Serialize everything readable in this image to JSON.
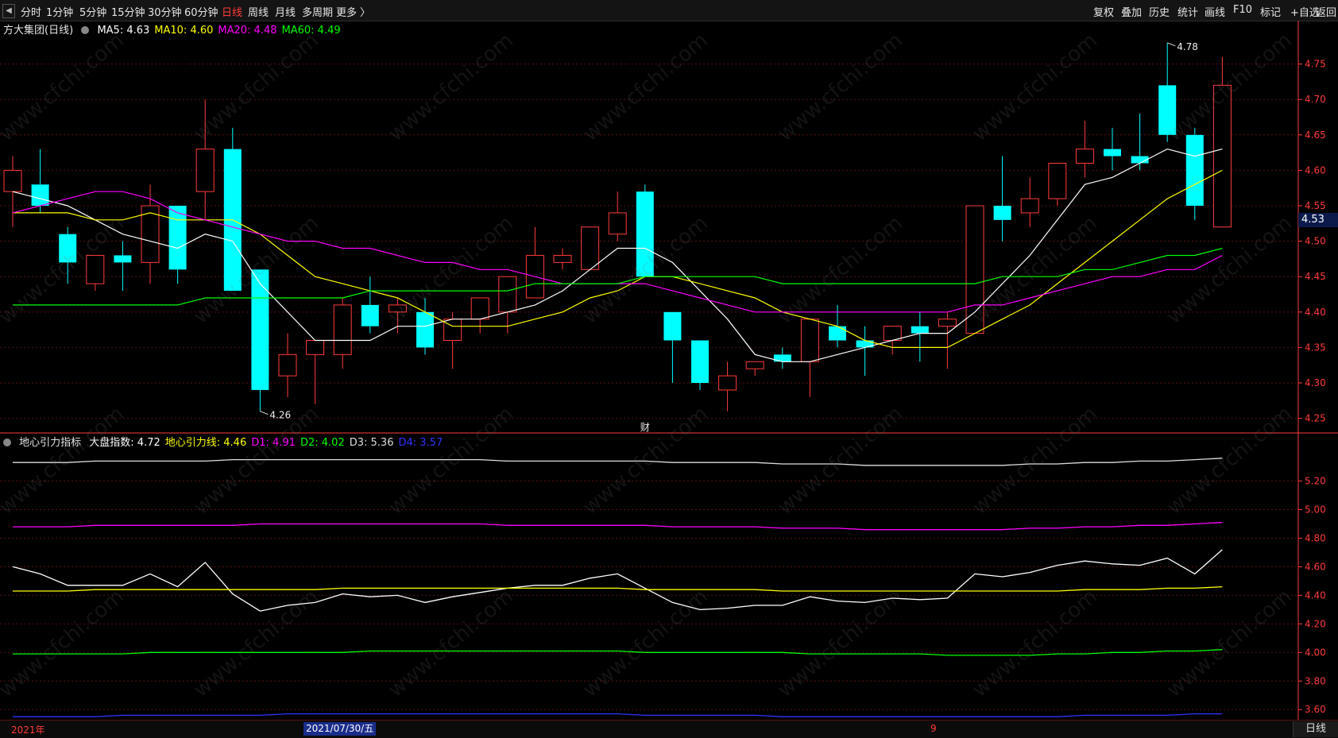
{
  "toolbar": {
    "left_items": [
      "分时",
      "1分钟",
      "5分钟",
      "15分钟",
      "30分钟",
      "60分钟",
      "日线",
      "周线",
      "月线",
      "多周期",
      "更多 〉"
    ],
    "active_index": 6,
    "right_items": [
      "复权",
      "叠加",
      "历史",
      "统计",
      "画线",
      "F10",
      "+自选",
      "返回"
    ],
    "mark_label": "标记"
  },
  "main_legend": {
    "title": "方大集团(日线)",
    "items": [
      {
        "label": "MA5: 4.63",
        "color": "#ffffff"
      },
      {
        "label": "MA10: 4.60",
        "color": "#ffff00"
      },
      {
        "label": "MA20: 4.48",
        "color": "#ff00ff"
      },
      {
        "label": "MA60: 4.49",
        "color": "#00ff00"
      }
    ]
  },
  "sub_legend": {
    "title": "地心引力指标",
    "items": [
      {
        "label": "大盘指数: 4.72",
        "color": "#ffffff"
      },
      {
        "label": "地心引力线: 4.46",
        "color": "#ffff00"
      },
      {
        "label": "D1: 4.91",
        "color": "#ff00ff"
      },
      {
        "label": "D2: 4.02",
        "color": "#00ff00"
      },
      {
        "label": "D3: 5.36",
        "color": "#dddddd"
      },
      {
        "label": "D4: 3.57",
        "color": "#3333ff"
      }
    ]
  },
  "price_tag": "4.53",
  "watermark": "www.cfchi.com",
  "bottom": {
    "year_label": "2021年",
    "date_label": "2021/07/30/五",
    "month_label": "9",
    "daily_button": "日线"
  },
  "colors": {
    "up": "#ff3b3b",
    "down": "#00ffff",
    "axis": "#ff3b3b",
    "grid": "#5a1010"
  },
  "chart_data": [
    {
      "type": "candlestick",
      "title": "方大集团(日线)",
      "ylim": [
        4.235,
        4.8
      ],
      "yticks": [
        4.25,
        4.3,
        4.35,
        4.4,
        4.45,
        4.5,
        4.55,
        4.6,
        4.65,
        4.7,
        4.75
      ],
      "candles": [
        {
          "o": 4.57,
          "c": 4.6,
          "h": 4.62,
          "l": 4.52
        },
        {
          "o": 4.58,
          "c": 4.55,
          "h": 4.63,
          "l": 4.54
        },
        {
          "o": 4.51,
          "c": 4.47,
          "h": 4.52,
          "l": 4.44
        },
        {
          "o": 4.44,
          "c": 4.48,
          "h": 4.48,
          "l": 4.43
        },
        {
          "o": 4.48,
          "c": 4.47,
          "h": 4.5,
          "l": 4.43
        },
        {
          "o": 4.47,
          "c": 4.55,
          "h": 4.58,
          "l": 4.44
        },
        {
          "o": 4.55,
          "c": 4.46,
          "h": 4.55,
          "l": 4.44
        },
        {
          "o": 4.57,
          "c": 4.63,
          "h": 4.7,
          "l": 4.53
        },
        {
          "o": 4.63,
          "c": 4.43,
          "h": 4.66,
          "l": 4.43
        },
        {
          "o": 4.46,
          "c": 4.29,
          "h": 4.46,
          "l": 4.26
        },
        {
          "o": 4.31,
          "c": 4.34,
          "h": 4.37,
          "l": 4.28
        },
        {
          "o": 4.34,
          "c": 4.36,
          "h": 4.36,
          "l": 4.27
        },
        {
          "o": 4.34,
          "c": 4.41,
          "h": 4.42,
          "l": 4.32
        },
        {
          "o": 4.41,
          "c": 4.38,
          "h": 4.45,
          "l": 4.37
        },
        {
          "o": 4.4,
          "c": 4.41,
          "h": 4.42,
          "l": 4.37
        },
        {
          "o": 4.4,
          "c": 4.35,
          "h": 4.42,
          "l": 4.34
        },
        {
          "o": 4.36,
          "c": 4.39,
          "h": 4.4,
          "l": 4.32
        },
        {
          "o": 4.39,
          "c": 4.42,
          "h": 4.42,
          "l": 4.37
        },
        {
          "o": 4.4,
          "c": 4.45,
          "h": 4.45,
          "l": 4.37
        },
        {
          "o": 4.42,
          "c": 4.48,
          "h": 4.52,
          "l": 4.42
        },
        {
          "o": 4.47,
          "c": 4.48,
          "h": 4.49,
          "l": 4.46
        },
        {
          "o": 4.46,
          "c": 4.52,
          "h": 4.52,
          "l": 4.46
        },
        {
          "o": 4.51,
          "c": 4.54,
          "h": 4.57,
          "l": 4.5
        },
        {
          "o": 4.57,
          "c": 4.45,
          "h": 4.58,
          "l": 4.45
        },
        {
          "o": 4.4,
          "c": 4.36,
          "h": 4.4,
          "l": 4.3
        },
        {
          "o": 4.36,
          "c": 4.3,
          "h": 4.36,
          "l": 4.29
        },
        {
          "o": 4.29,
          "c": 4.31,
          "h": 4.33,
          "l": 4.26
        },
        {
          "o": 4.32,
          "c": 4.33,
          "h": 4.33,
          "l": 4.31
        },
        {
          "o": 4.34,
          "c": 4.33,
          "h": 4.35,
          "l": 4.32
        },
        {
          "o": 4.33,
          "c": 4.39,
          "h": 4.39,
          "l": 4.28
        },
        {
          "o": 4.38,
          "c": 4.36,
          "h": 4.41,
          "l": 4.35
        },
        {
          "o": 4.36,
          "c": 4.35,
          "h": 4.38,
          "l": 4.31
        },
        {
          "o": 4.36,
          "c": 4.38,
          "h": 4.38,
          "l": 4.34
        },
        {
          "o": 4.38,
          "c": 4.37,
          "h": 4.4,
          "l": 4.33
        },
        {
          "o": 4.38,
          "c": 4.39,
          "h": 4.4,
          "l": 4.32
        },
        {
          "o": 4.37,
          "c": 4.55,
          "h": 4.55,
          "l": 4.37
        },
        {
          "o": 4.55,
          "c": 4.53,
          "h": 4.62,
          "l": 4.5
        },
        {
          "o": 4.54,
          "c": 4.56,
          "h": 4.59,
          "l": 4.52
        },
        {
          "o": 4.56,
          "c": 4.61,
          "h": 4.61,
          "l": 4.55
        },
        {
          "o": 4.61,
          "c": 4.63,
          "h": 4.67,
          "l": 4.59
        },
        {
          "o": 4.63,
          "c": 4.62,
          "h": 4.66,
          "l": 4.6
        },
        {
          "o": 4.62,
          "c": 4.61,
          "h": 4.68,
          "l": 4.6
        },
        {
          "o": 4.72,
          "c": 4.65,
          "h": 4.78,
          "l": 4.64
        },
        {
          "o": 4.65,
          "c": 4.55,
          "h": 4.66,
          "l": 4.53
        },
        {
          "o": 4.52,
          "c": 4.72,
          "h": 4.76,
          "l": 4.52
        }
      ],
      "ma": [
        {
          "name": "MA5",
          "color": "#ffffff",
          "values": [
            4.57,
            4.56,
            4.55,
            4.53,
            4.51,
            4.5,
            4.49,
            4.51,
            4.5,
            4.44,
            4.4,
            4.36,
            4.36,
            4.36,
            4.38,
            4.38,
            4.39,
            4.39,
            4.4,
            4.41,
            4.43,
            4.46,
            4.49,
            4.49,
            4.47,
            4.43,
            4.39,
            4.34,
            4.33,
            4.33,
            4.34,
            4.35,
            4.36,
            4.37,
            4.37,
            4.4,
            4.44,
            4.48,
            4.53,
            4.58,
            4.59,
            4.61,
            4.63,
            4.62,
            4.63
          ]
        },
        {
          "name": "MA10",
          "color": "#ffff00",
          "values": [
            4.54,
            4.54,
            4.54,
            4.53,
            4.53,
            4.54,
            4.53,
            4.53,
            4.53,
            4.51,
            4.48,
            4.45,
            4.44,
            4.43,
            4.42,
            4.4,
            4.38,
            4.38,
            4.38,
            4.39,
            4.4,
            4.42,
            4.43,
            4.45,
            4.45,
            4.44,
            4.43,
            4.42,
            4.4,
            4.39,
            4.38,
            4.36,
            4.35,
            4.35,
            4.35,
            4.37,
            4.39,
            4.41,
            4.44,
            4.47,
            4.5,
            4.53,
            4.56,
            4.58,
            4.6
          ]
        },
        {
          "name": "MA20",
          "color": "#ff00ff",
          "values": [
            4.54,
            4.55,
            4.56,
            4.57,
            4.57,
            4.56,
            4.54,
            4.53,
            4.52,
            4.51,
            4.5,
            4.5,
            4.49,
            4.49,
            4.48,
            4.47,
            4.47,
            4.46,
            4.46,
            4.45,
            4.44,
            4.44,
            4.44,
            4.44,
            4.43,
            4.42,
            4.41,
            4.4,
            4.4,
            4.4,
            4.4,
            4.4,
            4.4,
            4.4,
            4.4,
            4.41,
            4.41,
            4.42,
            4.43,
            4.44,
            4.45,
            4.45,
            4.46,
            4.46,
            4.48
          ]
        },
        {
          "name": "MA60",
          "color": "#00ff00",
          "values": [
            4.41,
            4.41,
            4.41,
            4.41,
            4.41,
            4.41,
            4.41,
            4.42,
            4.42,
            4.42,
            4.42,
            4.42,
            4.42,
            4.43,
            4.43,
            4.43,
            4.43,
            4.43,
            4.43,
            4.44,
            4.44,
            4.44,
            4.44,
            4.45,
            4.45,
            4.45,
            4.45,
            4.45,
            4.44,
            4.44,
            4.44,
            4.44,
            4.44,
            4.44,
            4.44,
            4.44,
            4.45,
            4.45,
            4.45,
            4.46,
            4.46,
            4.47,
            4.48,
            4.48,
            4.49
          ]
        }
      ],
      "annotations": [
        {
          "label": "4.78",
          "index": 42,
          "value": 4.78
        },
        {
          "label": "4.26",
          "index": 9,
          "value": 4.26
        },
        {
          "label": "财",
          "index": 23
        }
      ]
    },
    {
      "type": "line",
      "title": "地心引力指标",
      "ylim": [
        3.54,
        5.42
      ],
      "yticks": [
        3.6,
        3.8,
        4.0,
        4.2,
        4.4,
        4.6,
        4.8,
        5.0,
        5.2
      ],
      "series": [
        {
          "name": "大盘指数",
          "color": "#ffffff",
          "values": [
            4.6,
            4.55,
            4.47,
            4.47,
            4.47,
            4.55,
            4.46,
            4.63,
            4.41,
            4.29,
            4.33,
            4.35,
            4.41,
            4.39,
            4.4,
            4.35,
            4.39,
            4.42,
            4.45,
            4.47,
            4.47,
            4.52,
            4.55,
            4.45,
            4.35,
            4.3,
            4.31,
            4.33,
            4.33,
            4.39,
            4.36,
            4.35,
            4.38,
            4.37,
            4.38,
            4.55,
            4.53,
            4.56,
            4.61,
            4.64,
            4.62,
            4.61,
            4.66,
            4.55,
            4.72
          ]
        },
        {
          "name": "地心引力线",
          "color": "#ffff00",
          "values": [
            4.43,
            4.43,
            4.43,
            4.44,
            4.44,
            4.44,
            4.44,
            4.44,
            4.44,
            4.44,
            4.44,
            4.44,
            4.45,
            4.45,
            4.45,
            4.45,
            4.45,
            4.45,
            4.45,
            4.45,
            4.45,
            4.45,
            4.45,
            4.44,
            4.44,
            4.44,
            4.44,
            4.44,
            4.43,
            4.43,
            4.43,
            4.43,
            4.43,
            4.43,
            4.43,
            4.43,
            4.43,
            4.43,
            4.43,
            4.44,
            4.44,
            4.44,
            4.45,
            4.45,
            4.46
          ]
        },
        {
          "name": "D1",
          "color": "#ff00ff",
          "values": [
            4.88,
            4.88,
            4.88,
            4.89,
            4.89,
            4.89,
            4.89,
            4.89,
            4.89,
            4.9,
            4.9,
            4.9,
            4.9,
            4.9,
            4.9,
            4.9,
            4.9,
            4.9,
            4.89,
            4.89,
            4.89,
            4.89,
            4.89,
            4.89,
            4.88,
            4.88,
            4.88,
            4.88,
            4.87,
            4.87,
            4.87,
            4.86,
            4.86,
            4.86,
            4.86,
            4.86,
            4.86,
            4.87,
            4.87,
            4.88,
            4.88,
            4.89,
            4.89,
            4.9,
            4.91
          ]
        },
        {
          "name": "D2",
          "color": "#00ff00",
          "values": [
            3.99,
            3.99,
            3.99,
            3.99,
            3.99,
            4.0,
            4.0,
            4.0,
            4.0,
            4.0,
            4.0,
            4.0,
            4.0,
            4.01,
            4.01,
            4.01,
            4.01,
            4.01,
            4.01,
            4.01,
            4.01,
            4.01,
            4.01,
            4.0,
            4.0,
            4.0,
            4.0,
            4.0,
            4.0,
            3.99,
            3.99,
            3.99,
            3.99,
            3.99,
            3.98,
            3.98,
            3.98,
            3.98,
            3.99,
            3.99,
            4.0,
            4.0,
            4.01,
            4.01,
            4.02
          ]
        },
        {
          "name": "D3",
          "color": "#dddddd",
          "values": [
            5.33,
            5.33,
            5.33,
            5.34,
            5.34,
            5.34,
            5.34,
            5.34,
            5.35,
            5.35,
            5.35,
            5.35,
            5.35,
            5.35,
            5.35,
            5.35,
            5.35,
            5.35,
            5.34,
            5.34,
            5.34,
            5.34,
            5.34,
            5.34,
            5.33,
            5.33,
            5.33,
            5.33,
            5.32,
            5.32,
            5.32,
            5.31,
            5.31,
            5.31,
            5.31,
            5.31,
            5.31,
            5.32,
            5.32,
            5.33,
            5.33,
            5.34,
            5.34,
            5.35,
            5.36
          ]
        },
        {
          "name": "D4",
          "color": "#3333ff",
          "values": [
            3.55,
            3.55,
            3.55,
            3.55,
            3.56,
            3.56,
            3.56,
            3.56,
            3.56,
            3.56,
            3.57,
            3.57,
            3.57,
            3.57,
            3.57,
            3.57,
            3.57,
            3.57,
            3.57,
            3.57,
            3.57,
            3.57,
            3.57,
            3.56,
            3.56,
            3.56,
            3.56,
            3.56,
            3.55,
            3.55,
            3.55,
            3.55,
            3.55,
            3.55,
            3.55,
            3.55,
            3.55,
            3.55,
            3.55,
            3.56,
            3.56,
            3.56,
            3.56,
            3.57,
            3.57
          ]
        }
      ]
    }
  ]
}
